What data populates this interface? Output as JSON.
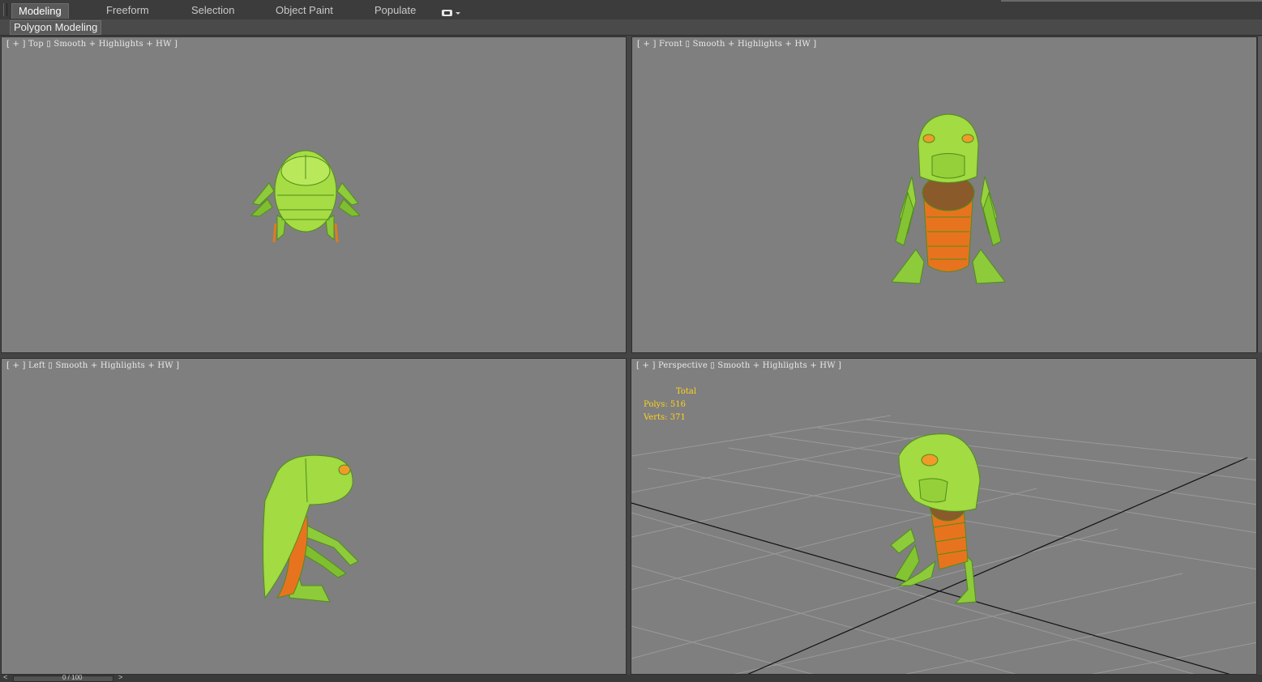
{
  "ribbon": {
    "tabs": [
      "Modeling",
      "Freeform",
      "Selection",
      "Object Paint",
      "Populate"
    ],
    "active_tab": "Modeling",
    "options_icon": "ribbon-options-icon",
    "panel_label": "Polygon Modeling"
  },
  "viewports": {
    "top": {
      "label_plus": "[ + ]",
      "label_view": "Top",
      "label_shading": "Smooth + Highlights + HW ]"
    },
    "front": {
      "label_plus": "[ + ]",
      "label_view": "Front",
      "label_shading": "Smooth + Highlights + HW ]"
    },
    "left": {
      "label_plus": "[ + ]",
      "label_view": "Left",
      "label_shading": "Smooth + Highlights + HW ]"
    },
    "perspective": {
      "label_plus": "[ + ]",
      "label_view": "Perspective",
      "label_shading": "Smooth + Highlights + HW ]",
      "stats": {
        "title": "Total",
        "polys_label": "Polys:",
        "polys_value": "516",
        "verts_label": "Verts:",
        "verts_value": "371"
      }
    }
  },
  "timeline": {
    "frame_text": "0 / 100",
    "prev_icon": "<",
    "next_icon": ">"
  },
  "colors": {
    "viewport_bg": "#7f7f7f",
    "model_green": "#8fd03a",
    "model_orange": "#e8731e",
    "model_brown": "#8a5a2b",
    "stats_yellow": "#ffd21a"
  }
}
